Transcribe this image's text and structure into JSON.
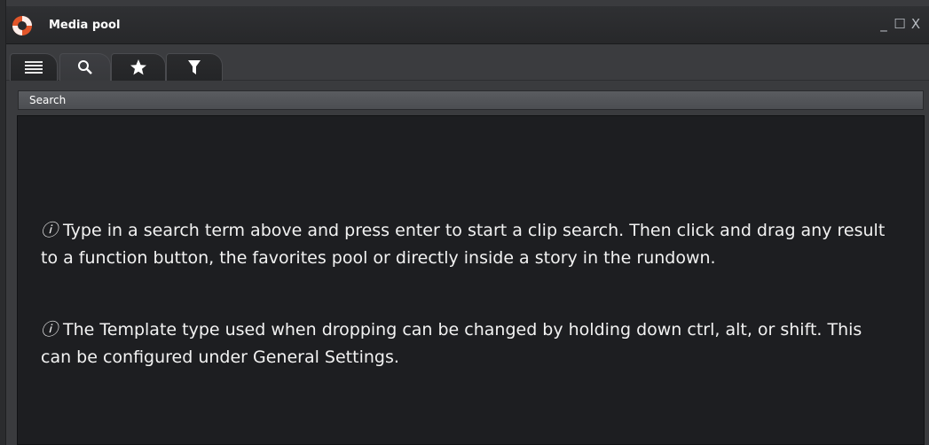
{
  "window": {
    "title": "Media pool",
    "controls": {
      "minimize": "_",
      "maximize": "☐",
      "close": "X"
    }
  },
  "tabs": [
    {
      "name": "list",
      "icon": "list-icon"
    },
    {
      "name": "search",
      "icon": "search-icon",
      "active": true
    },
    {
      "name": "favorites",
      "icon": "star-icon"
    },
    {
      "name": "filter",
      "icon": "filter-icon"
    }
  ],
  "search": {
    "header_label": "Search"
  },
  "hints": {
    "icon_glyph": "ⓘ",
    "hint1": "Type in a search term above and press enter to start a clip search. Then click and drag any result to a function button, the favorites pool or directly inside a story in the rundown.",
    "hint2": "The Template type used when dropping can be changed by holding down ctrl, alt, or shift. This can be configured under General Settings."
  },
  "colors": {
    "content_bg": "#1d1e21",
    "logo_orange": "#e2562a",
    "text": "#f2f2f2"
  }
}
